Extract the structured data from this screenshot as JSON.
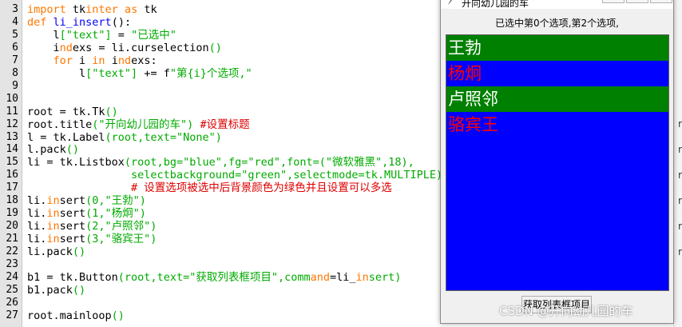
{
  "editor": {
    "lines": [
      {
        "n": "3",
        "segs": [
          {
            "t": "import",
            "c": "kw"
          },
          {
            "t": " tk"
          },
          {
            "t": "inter",
            "c": "kw"
          },
          {
            "t": " "
          },
          {
            "t": "as",
            "c": "kw"
          },
          {
            "t": " tk"
          }
        ]
      },
      {
        "n": "4",
        "segs": [
          {
            "t": "def",
            "c": "kw"
          },
          {
            "t": " "
          },
          {
            "t": "li_insert",
            "c": "fn"
          },
          {
            "t": "():"
          }
        ]
      },
      {
        "n": "5",
        "segs": [
          {
            "t": "    l"
          },
          {
            "t": "[\"text\"]",
            "c": "st"
          },
          {
            "t": " = "
          },
          {
            "t": "\"已选中\"",
            "c": "st"
          }
        ]
      },
      {
        "n": "6",
        "segs": [
          {
            "t": "    i"
          },
          {
            "t": "nd",
            "c": "kw"
          },
          {
            "t": "exs = li.curselection"
          },
          {
            "t": "()",
            "c": "st"
          }
        ]
      },
      {
        "n": "7",
        "segs": [
          {
            "t": "    "
          },
          {
            "t": "for",
            "c": "kw"
          },
          {
            "t": " i "
          },
          {
            "t": "in",
            "c": "kw"
          },
          {
            "t": " i"
          },
          {
            "t": "nd",
            "c": "kw"
          },
          {
            "t": "exs:"
          }
        ]
      },
      {
        "n": "8",
        "segs": [
          {
            "t": "        l"
          },
          {
            "t": "[\"text\"]",
            "c": "st"
          },
          {
            "t": " += f"
          },
          {
            "t": "\"第{i}个选项,\"",
            "c": "st"
          }
        ]
      },
      {
        "n": "9",
        "segs": []
      },
      {
        "n": "10",
        "segs": []
      },
      {
        "n": "11",
        "segs": [
          {
            "t": "root = tk.Tk"
          },
          {
            "t": "()",
            "c": "st"
          }
        ]
      },
      {
        "n": "12",
        "segs": [
          {
            "t": "root.title"
          },
          {
            "t": "(\"开向幼儿园的车\")",
            "c": "st"
          },
          {
            "t": " "
          },
          {
            "t": "#设置标题",
            "c": "cm"
          }
        ]
      },
      {
        "n": "13",
        "segs": [
          {
            "t": "l = tk.Label"
          },
          {
            "t": "(root,text=\"None\")",
            "c": "st"
          }
        ]
      },
      {
        "n": "14",
        "segs": [
          {
            "t": "l.pack"
          },
          {
            "t": "()",
            "c": "st"
          }
        ]
      },
      {
        "n": "15",
        "segs": [
          {
            "t": "li = tk.Listbox"
          },
          {
            "t": "(root,bg=\"blue\",fg=\"red\",font=(\"微软雅黑\",18),",
            "c": "st"
          }
        ]
      },
      {
        "n": "16",
        "segs": [
          {
            "t": "                selectbackground=\"green\",selectmode=tk.MULTIPLE)",
            "c": "st"
          }
        ]
      },
      {
        "n": "17",
        "segs": [
          {
            "t": "                "
          },
          {
            "t": "# 设置选项被选中后背景颜色为绿色并且设置可以多选",
            "c": "cm"
          }
        ]
      },
      {
        "n": "18",
        "segs": [
          {
            "t": "li."
          },
          {
            "t": "in",
            "c": "kw"
          },
          {
            "t": "sert"
          },
          {
            "t": "(0,\"王勃\")",
            "c": "st"
          }
        ]
      },
      {
        "n": "19",
        "segs": [
          {
            "t": "li."
          },
          {
            "t": "in",
            "c": "kw"
          },
          {
            "t": "sert"
          },
          {
            "t": "(1,\"杨炯\")",
            "c": "st"
          }
        ]
      },
      {
        "n": "20",
        "segs": [
          {
            "t": "li."
          },
          {
            "t": "in",
            "c": "kw"
          },
          {
            "t": "sert"
          },
          {
            "t": "(2,\"卢照邻\")",
            "c": "st"
          }
        ]
      },
      {
        "n": "21",
        "segs": [
          {
            "t": "li."
          },
          {
            "t": "in",
            "c": "kw"
          },
          {
            "t": "sert"
          },
          {
            "t": "(3,\"骆宾王\")",
            "c": "st"
          }
        ]
      },
      {
        "n": "22",
        "segs": [
          {
            "t": "li.pack"
          },
          {
            "t": "()",
            "c": "st"
          }
        ]
      },
      {
        "n": "23",
        "segs": []
      },
      {
        "n": "24",
        "segs": [
          {
            "t": "b1 = tk.Button"
          },
          {
            "t": "(root,text=\"获取列表框项目\",",
            "c": "st"
          },
          {
            "t": "comm",
            "c": "st"
          },
          {
            "t": "and",
            "c": "kw"
          },
          {
            "t": "=li_"
          },
          {
            "t": "in",
            "c": "kw"
          },
          {
            "t": "sert)",
            "c": "st"
          }
        ]
      },
      {
        "n": "25",
        "segs": [
          {
            "t": "b1.pack"
          },
          {
            "t": "()",
            "c": "st"
          }
        ]
      },
      {
        "n": "26",
        "segs": []
      },
      {
        "n": "27",
        "segs": [
          {
            "t": "root.mai"
          },
          {
            "t": "nloop"
          },
          {
            "t": "()",
            "c": "st"
          }
        ]
      }
    ]
  },
  "tk_window": {
    "title": "开向幼儿园的车",
    "status_text": "已选中第0个选项,第2个选项,",
    "listbox": {
      "items": [
        {
          "label": "王勃",
          "selected": true
        },
        {
          "label": "杨炯",
          "selected": false
        },
        {
          "label": "卢照邻",
          "selected": true
        },
        {
          "label": "骆宾王",
          "selected": false
        }
      ],
      "bg_color": "#0000ff",
      "fg_color": "#ff0000",
      "select_bg_color": "#008000"
    },
    "button_label": "获取列表框项目"
  },
  "watermark": "CSDN @开向幼儿园的车",
  "colors": {
    "keyword": "#ff7700",
    "string": "#00aa00",
    "comment": "#dd0000",
    "function": "#0000ff"
  }
}
